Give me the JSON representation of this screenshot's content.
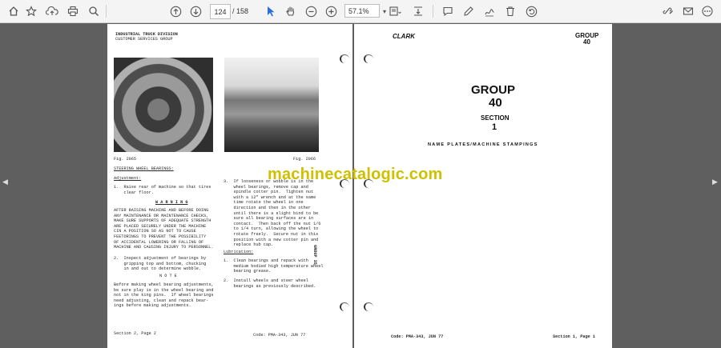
{
  "toolbar": {
    "page_current": "124",
    "page_total": "/ 158",
    "zoom": "57.1%"
  },
  "left_page": {
    "header1": "INDUSTRIAL TRUCK DIVISION",
    "header2": "CUSTOMER SERVICES GROUP",
    "fig1": "Fig. 2065",
    "fig2": "Fig. 2066",
    "steering_title": "STEERING WHEEL BEARINGS:",
    "adjustment_label": "Adjustment:",
    "step1": "1.  Raise rear of machine so that tires\n    clear floor.",
    "warning_title": "W A R N I N G",
    "warning_text": "AFTER RAISING MACHINE AND BEFORE DOING\nANY MAINTENANCE OR MAINTENANCE CHECKS,\nMAKE SURE SUPPORTS OF ADEQUATE STRENGTH\nARE PLACED SECURELY UNDER THE MACHINE\nCIN A POSITION SO AS NOT TO CAUSE\nFEETORINGS TO PREVENT THE POSSIBILITY\nOF ACCIDENTAL LOWERING OR FALLING OF\nMACHINE AND CAUSING INJURY TO PERSONNEL.",
    "step2": "2.  Inspect adjustment of bearings by\n    gripping top and bottom, chucking\n    in and out to determine wobble.",
    "note_title": "N O T E",
    "note_text": "Before making wheel bearing adjustments,\nbe sure play is in the wheel bearing and\nnot in the king pins.  If wheel bearings\nneed adjusting, clean and repack bear-\nings before making adjustments.",
    "step3": "3.  If looseness or wobble is in the\n    wheel bearings, remove cap and\n    spindle cotter pin.  Tighten nut\n    with a 12\" wrench and at the same\n    time rotate the wheel in one\n    direction and then in the other\n    until there is a slight bind to be\n    sure all bearing surfaces are in\n    contact.  Then back off the nut 1/6\n    to 1/4 turn, allowing the wheel to\n    rotate freely.  Secure nut in this\n    position with a new cotter pin and\n    replace hub cap.",
    "lubrication_label": "Lubrication:",
    "lub1": "1.  Clean bearings and repack with\n    medium bodied high temperature wheel\n    bearing grease.",
    "lub2": "2.  Install wheels and steer wheel\n    bearings as previously described.",
    "side_tab": "GROUP 35",
    "footer_left": "Section 2, Page 2",
    "footer_code": "Code: PMA-343, JUN 77"
  },
  "right_page": {
    "logo": "CLARK",
    "group_corner": "GROUP",
    "group_corner_num": "40",
    "group_title": "GROUP",
    "group_num": "40",
    "section_label": "SECTION",
    "section_num": "1",
    "subtitle": "NAME PLATES/MACHINE STAMPINGS",
    "footer_code": "Code: PMA-343, JUN 77",
    "footer_right": "Section 1, Page 1"
  },
  "watermark": "machinecatalogic.com"
}
